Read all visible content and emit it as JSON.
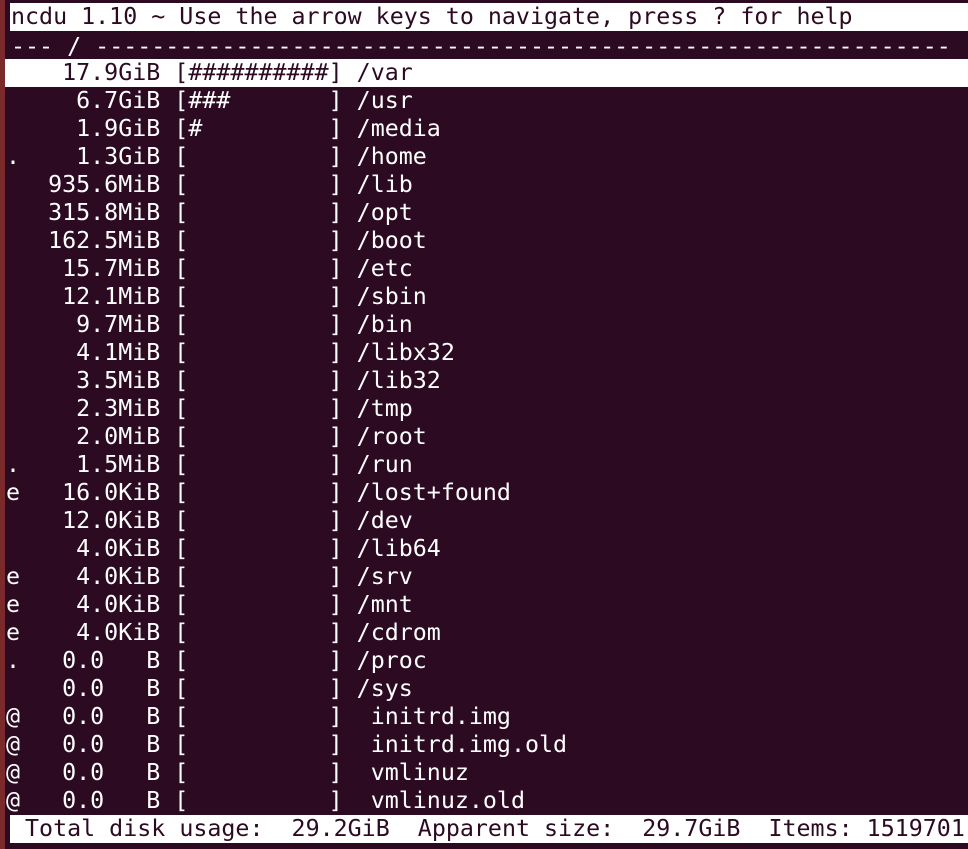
{
  "header": {
    "title": "ncdu 1.10 ~ Use the arrow keys to navigate, press ? for help"
  },
  "path_bar": {
    "prefix": "--- ",
    "path": "/",
    "suffix": " -------------------------------------------------------------"
  },
  "selected_index": 0,
  "entries": [
    {
      "flag": " ",
      "size": "17.9GiB",
      "bar": "##########",
      "name": "/var"
    },
    {
      "flag": " ",
      "size": " 6.7GiB",
      "bar": "###       ",
      "name": "/usr"
    },
    {
      "flag": " ",
      "size": " 1.9GiB",
      "bar": "#         ",
      "name": "/media"
    },
    {
      "flag": ".",
      "size": " 1.3GiB",
      "bar": "          ",
      "name": "/home"
    },
    {
      "flag": " ",
      "size": "935.6MiB",
      "bar": "          ",
      "name": "/lib"
    },
    {
      "flag": " ",
      "size": "315.8MiB",
      "bar": "          ",
      "name": "/opt"
    },
    {
      "flag": " ",
      "size": "162.5MiB",
      "bar": "          ",
      "name": "/boot"
    },
    {
      "flag": " ",
      "size": " 15.7MiB",
      "bar": "          ",
      "name": "/etc"
    },
    {
      "flag": " ",
      "size": " 12.1MiB",
      "bar": "          ",
      "name": "/sbin"
    },
    {
      "flag": " ",
      "size": "  9.7MiB",
      "bar": "          ",
      "name": "/bin"
    },
    {
      "flag": " ",
      "size": "  4.1MiB",
      "bar": "          ",
      "name": "/libx32"
    },
    {
      "flag": " ",
      "size": "  3.5MiB",
      "bar": "          ",
      "name": "/lib32"
    },
    {
      "flag": " ",
      "size": "  2.3MiB",
      "bar": "          ",
      "name": "/tmp"
    },
    {
      "flag": " ",
      "size": "  2.0MiB",
      "bar": "          ",
      "name": "/root"
    },
    {
      "flag": ".",
      "size": "  1.5MiB",
      "bar": "          ",
      "name": "/run"
    },
    {
      "flag": "e",
      "size": " 16.0KiB",
      "bar": "          ",
      "name": "/lost+found"
    },
    {
      "flag": " ",
      "size": " 12.0KiB",
      "bar": "          ",
      "name": "/dev"
    },
    {
      "flag": " ",
      "size": "  4.0KiB",
      "bar": "          ",
      "name": "/lib64"
    },
    {
      "flag": "e",
      "size": "  4.0KiB",
      "bar": "          ",
      "name": "/srv"
    },
    {
      "flag": "e",
      "size": "  4.0KiB",
      "bar": "          ",
      "name": "/mnt"
    },
    {
      "flag": "e",
      "size": "  4.0KiB",
      "bar": "          ",
      "name": "/cdrom"
    },
    {
      "flag": ".",
      "size": "  0.0   B",
      "bar": "          ",
      "name": "/proc"
    },
    {
      "flag": " ",
      "size": "  0.0   B",
      "bar": "          ",
      "name": "/sys"
    },
    {
      "flag": "@",
      "size": "  0.0   B",
      "bar": "          ",
      "name": " initrd.img"
    },
    {
      "flag": "@",
      "size": "  0.0   B",
      "bar": "          ",
      "name": " initrd.img.old"
    },
    {
      "flag": "@",
      "size": "  0.0   B",
      "bar": "          ",
      "name": " vmlinuz"
    },
    {
      "flag": "@",
      "size": "  0.0   B",
      "bar": "          ",
      "name": " vmlinuz.old"
    }
  ],
  "footer": {
    "total_label": "Total disk usage:",
    "total_value": "29.2GiB",
    "apparent_label": "Apparent size:",
    "apparent_value": "29.7GiB",
    "items_label": "Items:",
    "items_value": "1519701"
  },
  "colors": {
    "background": "#2c0a22",
    "foreground": "#ffffff",
    "border": "#7a2a2a"
  }
}
